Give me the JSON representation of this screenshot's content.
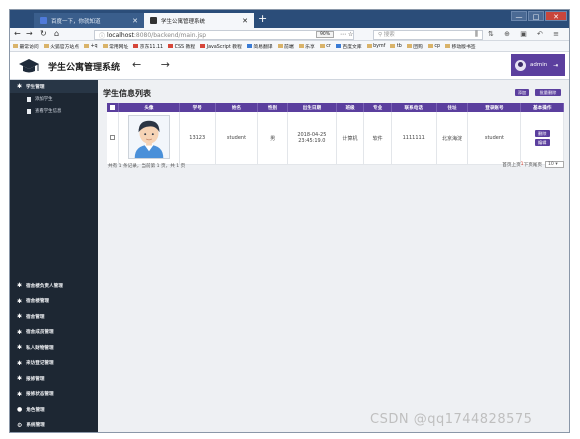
{
  "browser": {
    "tabs": [
      {
        "label": "百度一下，你就知道",
        "active": false
      },
      {
        "label": "学生公寓管理系统",
        "active": true
      }
    ],
    "new_tab": "+",
    "url_scheme": "ⓘ",
    "url_host": "localhost",
    "url_path": ":8080/backend/main.jsp",
    "zoom": "90%",
    "page_actions": "⋯ ☆",
    "search_placeholder": "搜索",
    "toolbar_icons": "⫼ ⇅ ⊕ ▣ ↶ ≡",
    "window_buttons": [
      "—",
      "□",
      "✕"
    ],
    "bookmarks": [
      "最常访问",
      "火狐官方站点",
      "+q",
      "常用网址",
      "京东11.11",
      "CSS 教程",
      "JavaScript 教程",
      "简易翻译",
      "前端",
      "乐享",
      "cr",
      "百度文库",
      "bymf",
      "tb",
      "团购",
      "cp",
      "移动版书签"
    ]
  },
  "app": {
    "title": "学生公寓管理系统",
    "nav_arrows": "← →",
    "user": "admin",
    "logout_icon": "⇥"
  },
  "sidebar": {
    "top_group": "学生管理",
    "sub_items": [
      "添加学生",
      "查看学生信息"
    ],
    "bottom_groups": [
      "宿舍楼负责人管理",
      "宿舍楼管理",
      "宿舍管理",
      "宿舍成员管理",
      "私人财物管理",
      "来访登记管理",
      "报修管理",
      "报修状态管理",
      "角色管理",
      "系统管理"
    ]
  },
  "content": {
    "title": "学生信息列表",
    "add_button": "添加",
    "batch_delete_button": "批量删除",
    "columns": [
      "",
      "头像",
      "学号",
      "姓名",
      "性别",
      "出生日期",
      "班级",
      "专业",
      "联系电话",
      "住址",
      "登录账号",
      "基本操作"
    ],
    "rows": [
      {
        "student_no": "13123",
        "name": "student",
        "gender": "男",
        "birth_date": "2018-04-25",
        "birth_time": "23:45:19.0",
        "class": "计算机",
        "major": "软件",
        "phone": "1111111",
        "address": "北京海淀",
        "account": "student",
        "actions": [
          "删除",
          "编辑"
        ]
      }
    ],
    "pager_left": "共有 1 条记录，当前第 1 页，共 1 页",
    "pager_right_prefix": "首页上页",
    "pager_right_current": "1",
    "pager_right_suffix": "下页尾页",
    "page_size": "10"
  },
  "watermark": "CSDN @qq1744828575",
  "colors": {
    "accent": "#5b3f9e",
    "sidebar": "#1d2733",
    "titlebar": "#2b4d79"
  }
}
